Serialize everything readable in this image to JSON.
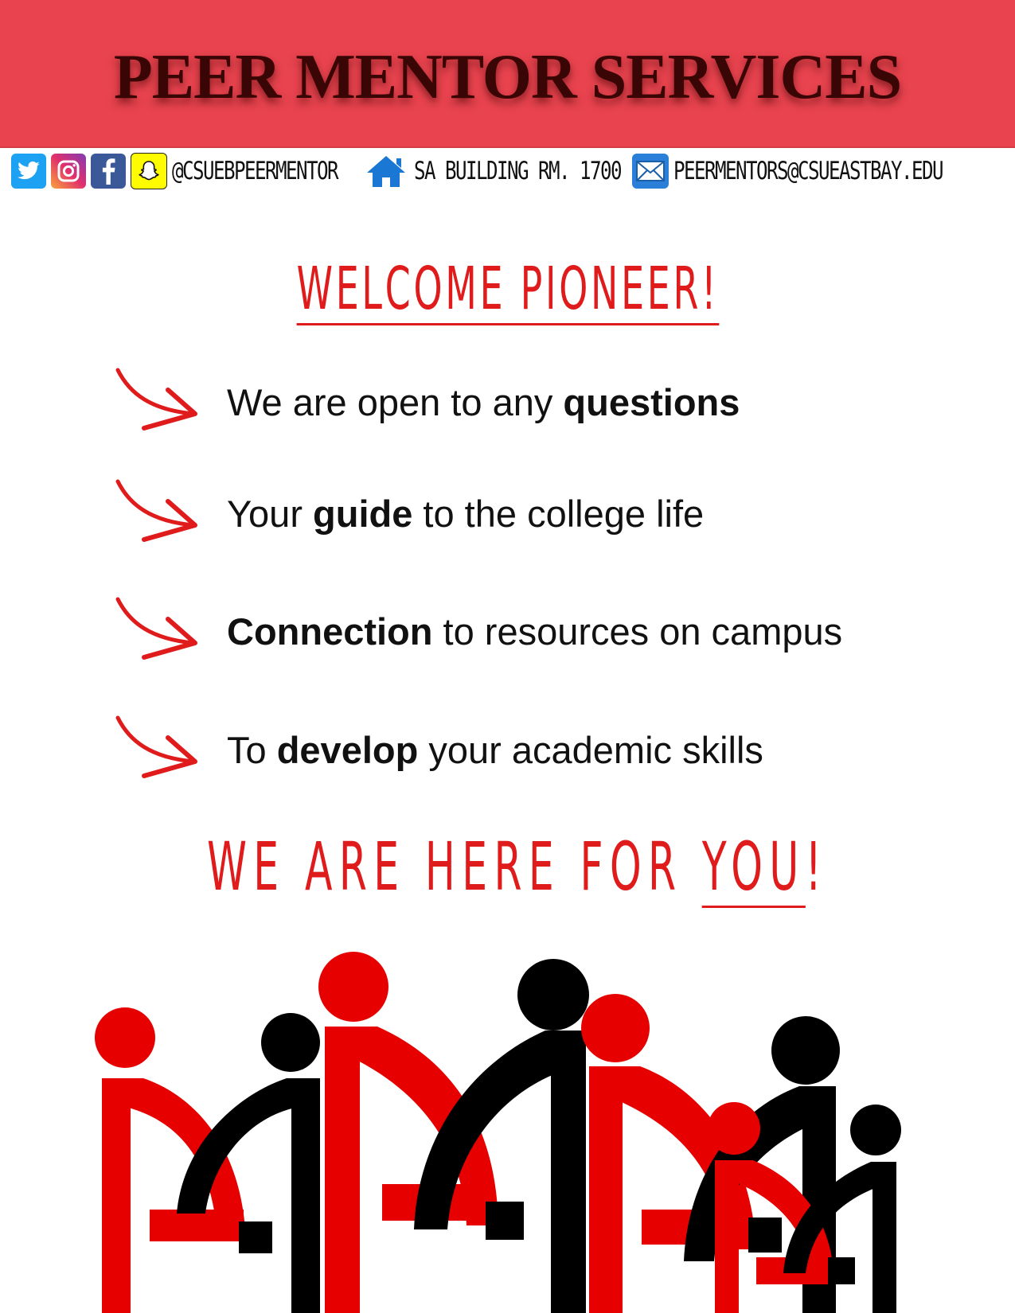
{
  "header": {
    "title": "PEER MENTOR SERVICES",
    "colors": {
      "banner": "#e8434e",
      "title": "#3a0505"
    }
  },
  "contact": {
    "social_icons": [
      "twitter-icon",
      "instagram-icon",
      "facebook-icon",
      "snapchat-icon"
    ],
    "handle": "@CSUEBPEERMENTOR",
    "location_icon": "home-icon",
    "location": "SA BUILDING RM. 1700",
    "email_icon": "mail-icon",
    "email": "PEERMENTORS@CSUEASTBAY.EDU"
  },
  "welcome": {
    "heading": "WELCOME PIONEER!"
  },
  "bullets": [
    {
      "pre": "We are open to any ",
      "bold": "questions",
      "post": ""
    },
    {
      "pre": "Your ",
      "bold": "guide",
      "post": " to the college life"
    },
    {
      "pre": "",
      "bold": "Connection",
      "post": " to resources on campus"
    },
    {
      "pre": "To ",
      "bold": "develop",
      "post": " your academic skills"
    }
  ],
  "closing": {
    "text": "WE ARE HERE FOR ",
    "emphasis": "YOU",
    "end": "!"
  },
  "accent_colors": {
    "red": "#e01b1b",
    "black": "#000000"
  }
}
